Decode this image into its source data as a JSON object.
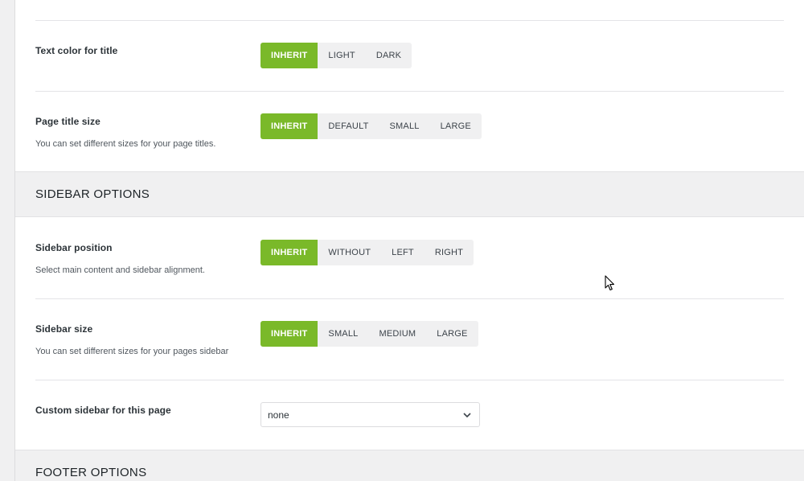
{
  "rows": {
    "title_color": {
      "title": "Text color for title",
      "options": [
        "INHERIT",
        "LIGHT",
        "DARK"
      ],
      "selected": "INHERIT"
    },
    "page_title_size": {
      "title": "Page title size",
      "desc": "You can set different sizes for your page titles.",
      "options": [
        "INHERIT",
        "DEFAULT",
        "SMALL",
        "LARGE"
      ],
      "selected": "INHERIT"
    },
    "sidebar_position": {
      "title": "Sidebar position",
      "desc": "Select main content and sidebar alignment.",
      "options": [
        "INHERIT",
        "WITHOUT",
        "LEFT",
        "RIGHT"
      ],
      "selected": "INHERIT"
    },
    "sidebar_size": {
      "title": "Sidebar size",
      "desc": "You can set different sizes for your pages sidebar",
      "options": [
        "INHERIT",
        "SMALL",
        "MEDIUM",
        "LARGE"
      ],
      "selected": "INHERIT"
    },
    "custom_sidebar": {
      "title": "Custom sidebar for this page",
      "value": "none"
    }
  },
  "sections": {
    "sidebar": "SIDEBAR OPTIONS",
    "footer": "FOOTER OPTIONS"
  },
  "colors": {
    "accent": "#7ab929",
    "section_bg": "#f0f0f1",
    "button_bg": "#f0f0f1"
  },
  "icons": {
    "select_chevron": "chevron-down-icon",
    "cursor": "mouse-pointer-icon"
  }
}
